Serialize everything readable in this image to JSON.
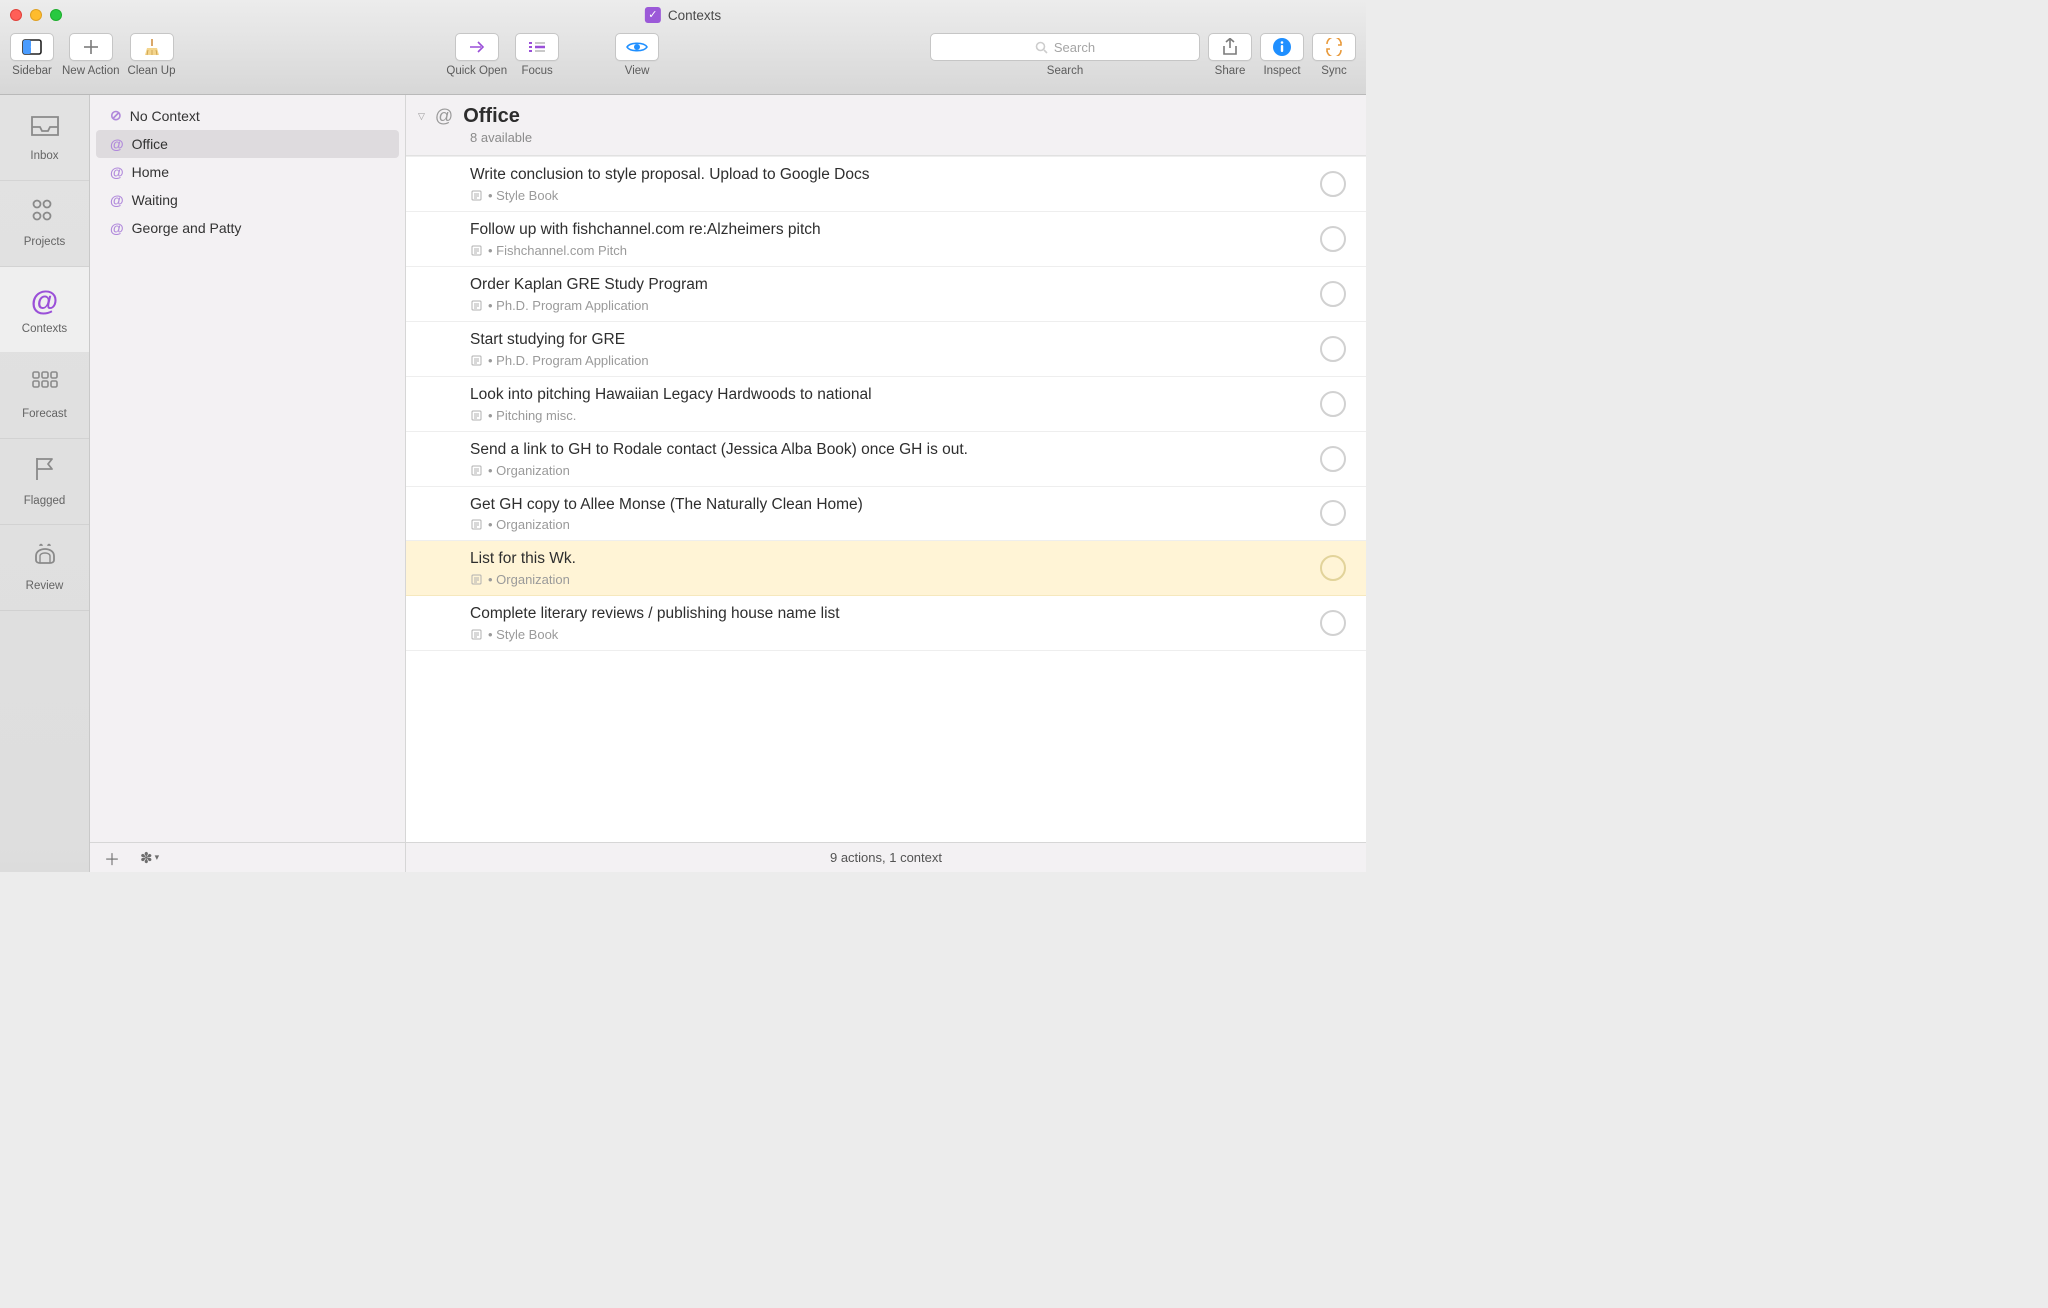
{
  "window": {
    "title": "Contexts"
  },
  "toolbar": {
    "sidebar": "Sidebar",
    "new_action": "New Action",
    "clean_up": "Clean Up",
    "quick_open": "Quick Open",
    "focus": "Focus",
    "view": "View",
    "search": "Search",
    "search_placeholder": "Search",
    "share": "Share",
    "inspect": "Inspect",
    "sync": "Sync"
  },
  "perspectives": [
    {
      "id": "inbox",
      "label": "Inbox",
      "selected": false
    },
    {
      "id": "projects",
      "label": "Projects",
      "selected": false
    },
    {
      "id": "contexts",
      "label": "Contexts",
      "selected": true
    },
    {
      "id": "forecast",
      "label": "Forecast",
      "selected": false
    },
    {
      "id": "flagged",
      "label": "Flagged",
      "selected": false
    },
    {
      "id": "review",
      "label": "Review",
      "selected": false
    }
  ],
  "contexts": {
    "items": [
      {
        "label": "No Context",
        "selected": false,
        "no_context": true
      },
      {
        "label": "Office",
        "selected": true
      },
      {
        "label": "Home",
        "selected": false
      },
      {
        "label": "Waiting",
        "selected": false
      },
      {
        "label": "George and Patty",
        "selected": false
      }
    ]
  },
  "header": {
    "title": "Office",
    "subtitle": "8 available"
  },
  "tasks": [
    {
      "title": "Write conclusion to style proposal. Upload to Google Docs",
      "project": "Style Book",
      "highlight": false
    },
    {
      "title": "Follow up with fishchannel.com re:Alzheimers pitch",
      "project": "Fishchannel.com Pitch",
      "highlight": false
    },
    {
      "title": "Order Kaplan GRE Study Program",
      "project": "Ph.D. Program Application",
      "highlight": false
    },
    {
      "title": "Start studying for GRE",
      "project": "Ph.D. Program Application",
      "highlight": false
    },
    {
      "title": "Look into pitching Hawaiian Legacy Hardwoods to national",
      "project": "Pitching misc.",
      "highlight": false
    },
    {
      "title": "Send a link to GH to Rodale contact (Jessica Alba Book) once GH is out.",
      "project": "Organization",
      "highlight": false
    },
    {
      "title": "Get GH copy to Allee Monse (The Naturally Clean Home)",
      "project": "Organization",
      "highlight": false
    },
    {
      "title": "List for this Wk.",
      "project": "Organization",
      "highlight": true
    },
    {
      "title": "Complete literary reviews / publishing house name list",
      "project": "Style Book",
      "highlight": false
    }
  ],
  "status": "9 actions, 1 context"
}
